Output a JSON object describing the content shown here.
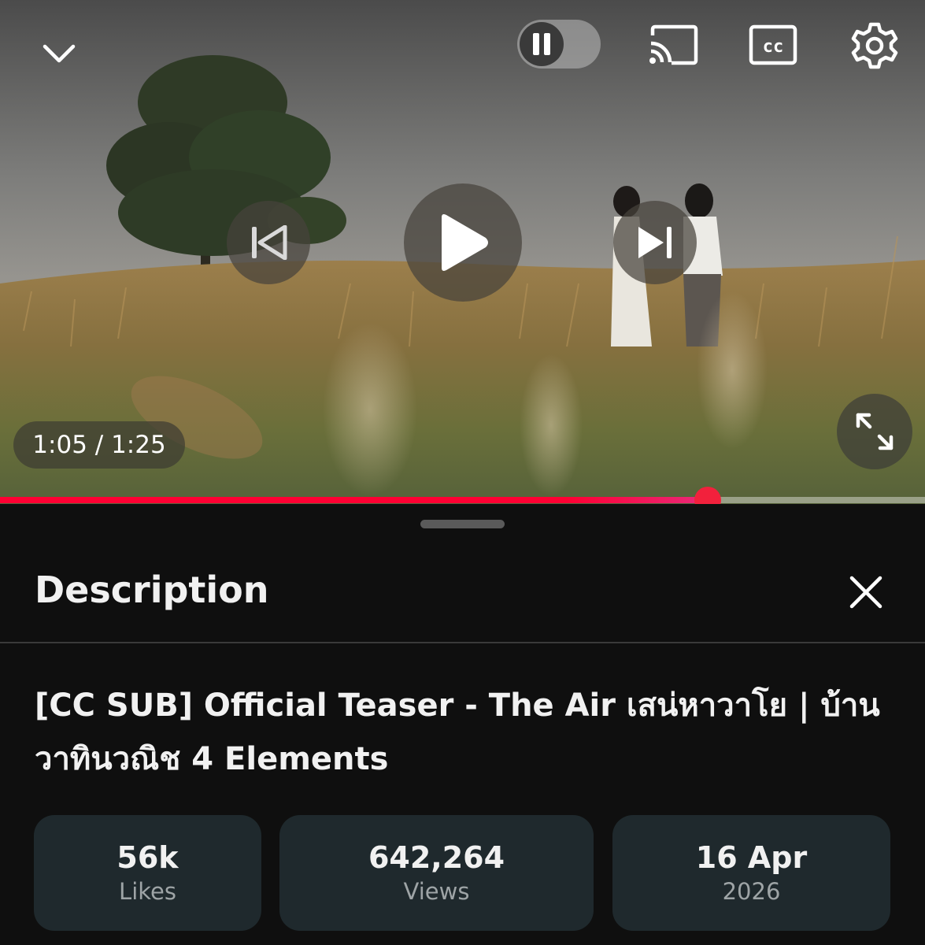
{
  "player": {
    "current_time": "1:05",
    "separator": " / ",
    "duration": "1:25",
    "progress": 0.765,
    "autoplay_on": false,
    "colors": {
      "progress_start": "#ff0033",
      "progress_end": "#e82a7a",
      "thumb": "#f2213c"
    },
    "icons": {
      "collapse": "chevron-down-icon",
      "autoplay": "pause-icon",
      "cast": "cast-icon",
      "captions": "closed-captions-icon",
      "settings": "gear-icon",
      "previous": "skip-previous-icon",
      "play": "play-icon",
      "next": "skip-next-icon",
      "fullscreen": "expand-icon"
    },
    "captions_glyph": "cc"
  },
  "description_panel": {
    "title": "Description",
    "close_icon": "close-icon",
    "video_title": "[CC SUB] Official Teaser - The Air เสน่หาวาโย | บ้านวาทินวณิช 4 Elements",
    "stats": {
      "likes": {
        "value": "56k",
        "label": "Likes"
      },
      "views": {
        "value": "642,264",
        "label": "Views"
      },
      "date": {
        "value": "16 Apr",
        "label": "2026"
      }
    },
    "colors": {
      "background": "#0f0f0f",
      "card": "#1f292d",
      "secondary_text": "#9ea4a6"
    }
  }
}
